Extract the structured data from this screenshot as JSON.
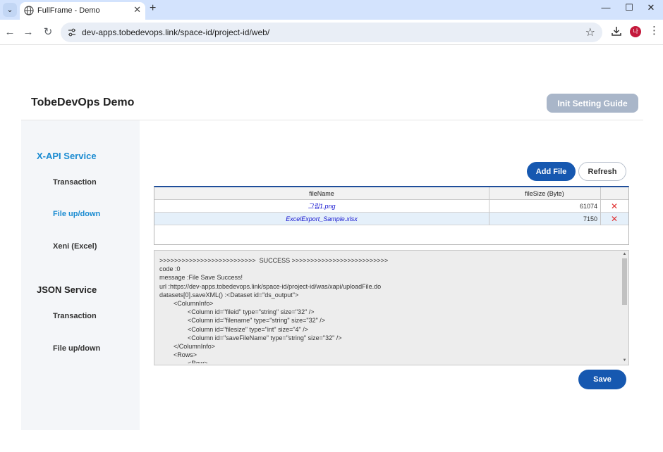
{
  "browser": {
    "tab_title": "FullFrame - Demo",
    "tab_close": "✕",
    "new_tab": "+",
    "url": "dev-apps.tobedevops.link/space-id/project-id/web/",
    "profile_initial": "나",
    "window_controls": {
      "minimize": "—",
      "maximize": "☐",
      "close": "✕"
    },
    "nav": {
      "back": "←",
      "forward": "→",
      "reload": "↻"
    },
    "star": "☆",
    "menu": "⋮",
    "tab_list": "⌄"
  },
  "app": {
    "title": "TobeDevOps Demo",
    "init_guide_label": "Init Setting Guide"
  },
  "sidebar": {
    "groups": [
      {
        "label": "X-API Service",
        "items": [
          "Transaction",
          "File up/down",
          "Xeni (Excel)"
        ]
      },
      {
        "label": "JSON Service",
        "items": [
          "Transaction",
          "File up/down"
        ]
      }
    ]
  },
  "toolbar": {
    "add_file_label": "Add File",
    "refresh_label": "Refresh",
    "save_label": "Save"
  },
  "grid": {
    "columns": [
      "fileName",
      "fileSize (Byte)",
      ""
    ],
    "rows": [
      {
        "fileName": "그림1.png",
        "fileSize": "61074",
        "delete": "✕"
      },
      {
        "fileName": "ExcelExport_Sample.xlsx",
        "fileSize": "7150",
        "delete": "✕"
      }
    ]
  },
  "log": {
    "text": ">>>>>>>>>>>>>>>>>>>>>>>>>>  SUCCESS >>>>>>>>>>>>>>>>>>>>>>>>>>\ncode :0\nmessage :File Save Success!\nurl :https://dev-apps.tobedevops.link/space-id/project-id/was/xapi/uploadFile.do\ndatasets[0].saveXML() :<Dataset id=\"ds_output\">\n        <ColumnInfo>\n                <Column id=\"fileid\" type=\"string\" size=\"32\" />\n                <Column id=\"filename\" type=\"string\" size=\"32\" />\n                <Column id=\"filesize\" type=\"int\" size=\"4\" />\n                <Column id=\"saveFileName\" type=\"string\" size=\"32\" />\n        </ColumnInfo>\n        <Rows>\n                <Row>"
  },
  "colors": {
    "accent": "#1a8bd1",
    "primary_button": "#1658b0",
    "guide_button": "#a9b6c9",
    "delete_icon": "#e03030",
    "file_link": "#1515d0"
  }
}
